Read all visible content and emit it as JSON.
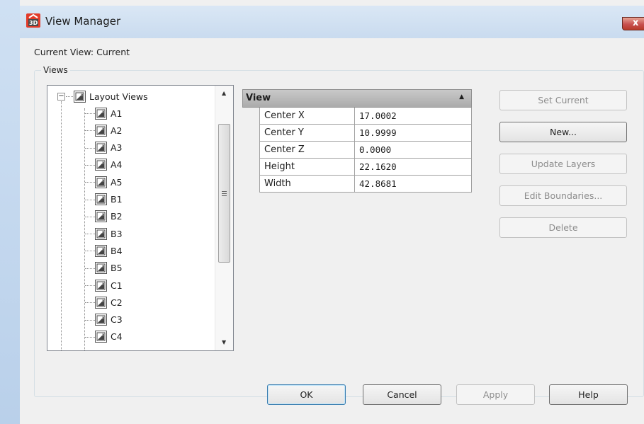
{
  "window": {
    "title": "View Manager",
    "close_glyph": "x"
  },
  "current_view": {
    "text": "Current View: Current"
  },
  "views_group": {
    "label": "Views"
  },
  "tree": {
    "root_label": "Layout Views",
    "expander_glyph": "−",
    "items": [
      "A1",
      "A2",
      "A3",
      "A4",
      "A5",
      "B1",
      "B2",
      "B3",
      "B4",
      "B5",
      "C1",
      "C2",
      "C3",
      "C4"
    ]
  },
  "properties": {
    "header": "View",
    "rows": [
      {
        "name": "Center X",
        "value": "17.0002"
      },
      {
        "name": "Center Y",
        "value": "10.9999"
      },
      {
        "name": "Center Z",
        "value": "0.0000"
      },
      {
        "name": "Height",
        "value": "22.1620"
      },
      {
        "name": "Width",
        "value": "42.8681"
      }
    ]
  },
  "side_buttons": {
    "set_current": "Set Current",
    "new": "New...",
    "update_layers": "Update Layers",
    "edit_boundaries": "Edit Boundaries...",
    "delete": "Delete"
  },
  "footer_buttons": {
    "ok": "OK",
    "cancel": "Cancel",
    "apply": "Apply",
    "help": "Help"
  },
  "colors": {
    "title_bar": "#c9dbef",
    "close": "#c75050",
    "dialog_bg": "#f0f0f0"
  }
}
